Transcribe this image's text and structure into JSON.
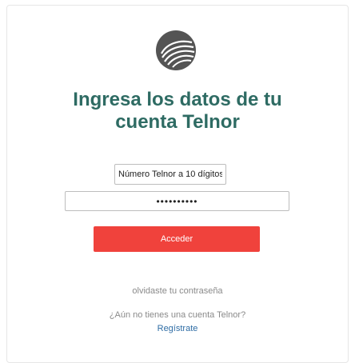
{
  "logo": {
    "icon": "telnor-logo-icon",
    "color": "#545454"
  },
  "title": {
    "line1": "Ingresa los datos de tu",
    "line2": "cuenta Telnor",
    "color": "#2e6b63"
  },
  "form": {
    "phone_value": "Número Telnor a 10 dígitos",
    "password_value": "••••••••••",
    "submit_label": "Acceder",
    "submit_color": "#f0423c"
  },
  "links": {
    "forgot": "olvidaste tu contraseña",
    "no_account": "¿Aún no tienes una cuenta Telnor?",
    "register": "Regístrate",
    "register_color": "#2f6da5"
  }
}
